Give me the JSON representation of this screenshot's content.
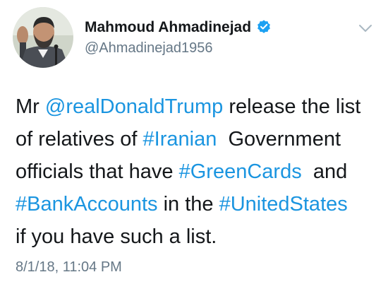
{
  "author": {
    "display_name": "Mahmoud Ahmadinejad",
    "handle": "@Ahmadinejad1956",
    "verified_icon": "verified-badge-icon",
    "avatar_icon": "profile-photo"
  },
  "menu": {
    "icon": "chevron-down-icon"
  },
  "tweet": {
    "lines": [
      [
        {
          "text": "Mr ",
          "type": "text"
        },
        {
          "text": "@realDonaldTrump",
          "type": "mention"
        },
        {
          "text": " release the list",
          "type": "text"
        }
      ],
      [
        {
          "text": "of relatives of ",
          "type": "text"
        },
        {
          "text": "#Iranian",
          "type": "hashtag"
        },
        {
          "text": "  Government",
          "type": "text"
        }
      ],
      [
        {
          "text": "officials that have ",
          "type": "text"
        },
        {
          "text": "#GreenCards",
          "type": "hashtag"
        },
        {
          "text": "  and",
          "type": "text"
        }
      ],
      [
        {
          "text": "#BankAccounts",
          "type": "hashtag"
        },
        {
          "text": " in the ",
          "type": "text"
        },
        {
          "text": "#UnitedStates",
          "type": "hashtag"
        }
      ],
      [
        {
          "text": "if you have such a list.",
          "type": "text"
        }
      ]
    ],
    "timestamp": "8/1/18, 11:04 PM"
  },
  "colors": {
    "link": "#1b95e0",
    "text": "#14171a",
    "secondary": "#657786",
    "verified": "#1da1f2"
  }
}
